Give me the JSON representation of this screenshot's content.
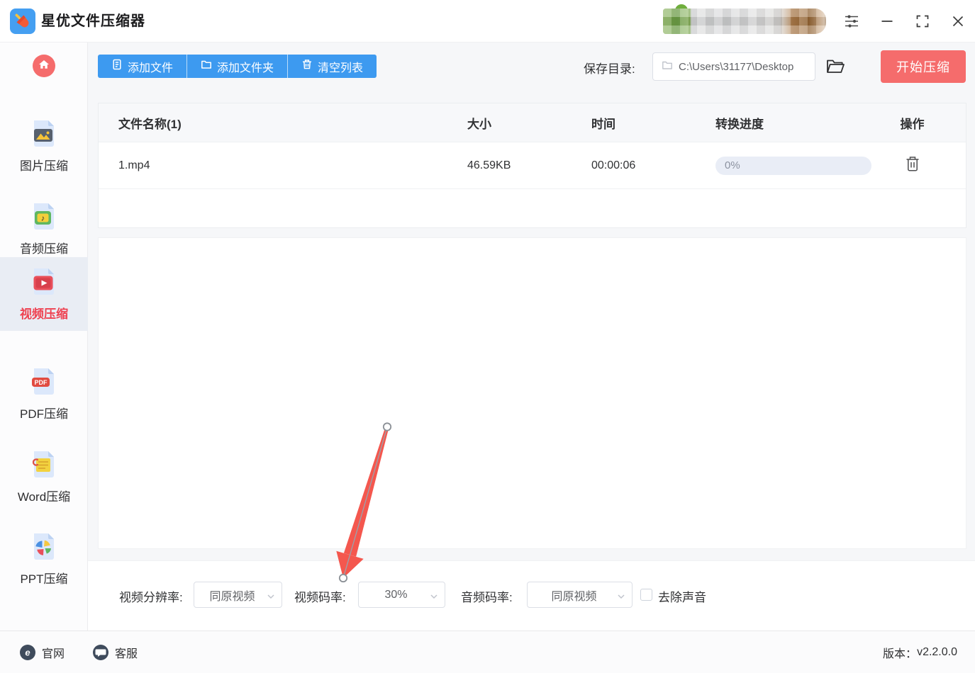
{
  "window": {
    "title": "星优文件压缩器"
  },
  "titlebar": {
    "icons": [
      "settings-sliders-icon",
      "minimize-icon",
      "maximize-icon",
      "close-icon"
    ],
    "user_area": "redacted-pixelated"
  },
  "sidebar": {
    "home_icon": "home-icon",
    "items": [
      {
        "label": "图片压缩",
        "icon": "image-file-icon",
        "active": false
      },
      {
        "label": "音频压缩",
        "icon": "audio-file-icon",
        "active": false
      },
      {
        "label": "视频压缩",
        "icon": "video-file-icon",
        "active": true
      },
      {
        "label": "PDF压缩",
        "icon": "pdf-file-icon",
        "active": false
      },
      {
        "label": "Word压缩",
        "icon": "word-file-icon",
        "active": false
      },
      {
        "label": "PPT压缩",
        "icon": "ppt-file-icon",
        "active": false
      }
    ]
  },
  "toolbar": {
    "add_file": "添加文件",
    "add_folder": "添加文件夹",
    "clear_list": "清空列表",
    "save_dir_label": "保存目录:",
    "save_dir_value": "C:\\Users\\31177\\Desktop",
    "start_compress": "开始压缩"
  },
  "file_table": {
    "headers": [
      "文件名称(1)",
      "大小",
      "时间",
      "转换进度",
      "操作"
    ],
    "rows": [
      {
        "name": "1.mp4",
        "size": "46.59KB",
        "time": "00:00:06",
        "progress_text": "0%",
        "progress_percent": 0
      }
    ]
  },
  "compress_settings": {
    "resolution_label": "视频分辨率:",
    "resolution_value": "同原视频",
    "bitrate_label": "视频码率:",
    "bitrate_value": "30%",
    "audio_bitrate_label": "音频码率:",
    "audio_bitrate_value": "同原视频",
    "remove_audio_label": "去除声音",
    "remove_audio_checked": false
  },
  "footer": {
    "official_site": "官网",
    "customer_service": "客服",
    "version_label": "版本：",
    "version_value": "v2.2.0.0"
  },
  "colors": {
    "primary_blue": "#3d9af0",
    "danger_red": "#f56c6c",
    "active_tab_red": "#ee4352",
    "annotation_arrow_red": "#f4574e",
    "progress_pill_bg": "#e9edf6",
    "active_item_bg": "#e9edf4"
  }
}
